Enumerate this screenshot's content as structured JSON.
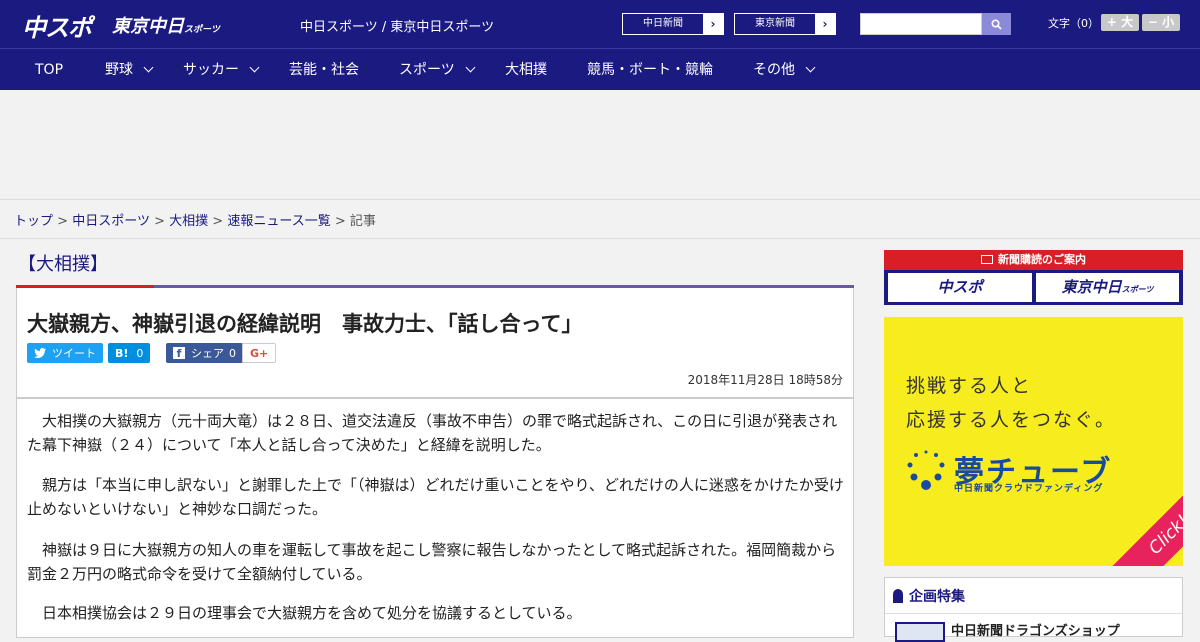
{
  "header": {
    "logo_main": "中スポ",
    "logo_tokyo": "東京中日",
    "logo_tokyo_small": "スポーツ",
    "site_name": "中日スポーツ / 東京中日スポーツ",
    "ext_links": [
      {
        "label": "中日新聞"
      },
      {
        "label": "東京新聞"
      }
    ],
    "search": {
      "value": "",
      "placeholder": ""
    },
    "fontsize": {
      "label": "文字（0）",
      "larger": "+ 大",
      "smaller": "− 小"
    }
  },
  "nav": {
    "items": [
      {
        "label": "TOP",
        "has_menu": false
      },
      {
        "label": "野球",
        "has_menu": true
      },
      {
        "label": "サッカー",
        "has_menu": true
      },
      {
        "label": "芸能・社会",
        "has_menu": false
      },
      {
        "label": "スポーツ",
        "has_menu": true
      },
      {
        "label": "大相撲",
        "has_menu": false
      },
      {
        "label": "競馬・ボート・競輪",
        "has_menu": false
      },
      {
        "label": "その他",
        "has_menu": true
      }
    ]
  },
  "breadcrumb": {
    "items": [
      "トップ",
      "中日スポーツ",
      "大相撲",
      "速報ニュース一覧"
    ],
    "current": "記事",
    "separator": ">"
  },
  "article": {
    "category": "【大相撲】",
    "headline": "大嶽親方、神嶽引退の経緯説明　事故力士、「話し合って」",
    "share": {
      "tweet": "ツイート",
      "hatena": "B!",
      "hatena_count": "0",
      "fb": "シェア",
      "fb_count": "0",
      "gplus": "G+"
    },
    "date": "2018年11月28日 18時58分",
    "paragraphs": [
      "大相撲の大嶽親方（元十両大竜）は２８日、道交法違反（事故不申告）の罪で略式起訴され、この日に引退が発表された幕下神嶽（２４）について「本人と話し合って決めた」と経緯を説明した。",
      "親方は「本当に申し訳ない」と謝罪した上で「（神嶽は）どれだけ重いことをやり、どれだけの人に迷惑をかけたか受け止めないといけない」と神妙な口調だった。",
      "神嶽は９日に大嶽親方の知人の車を運転して事故を起こし警察に報告しなかったとして略式起訴された。福岡簡裁から罰金２万円の略式命令を受けて全額納付している。",
      "日本相撲協会は２９日の理事会で大嶽親方を含めて処分を協議するとしている。"
    ]
  },
  "sidebar": {
    "subscribe": {
      "title": "新聞購読のご案内",
      "btn1": "中スポ",
      "btn2": "東京中日",
      "btn2_small": "スポーツ"
    },
    "yume": {
      "line1": "挑戦する人と",
      "line2": "応援する人をつなぐ。",
      "title": "夢チューブ",
      "sub": "中日新聞クラウドファンディング",
      "click": "Click!"
    },
    "kikaku": {
      "title": "企画特集",
      "item": "中日新聞ドラゴンズショップ"
    }
  },
  "colors": {
    "navy": "#1a1a80",
    "red": "#d81f26",
    "yume_yellow": "#f7ec1d",
    "twitter": "#1da1f2",
    "hatena": "#008fde",
    "facebook": "#3b5998"
  }
}
